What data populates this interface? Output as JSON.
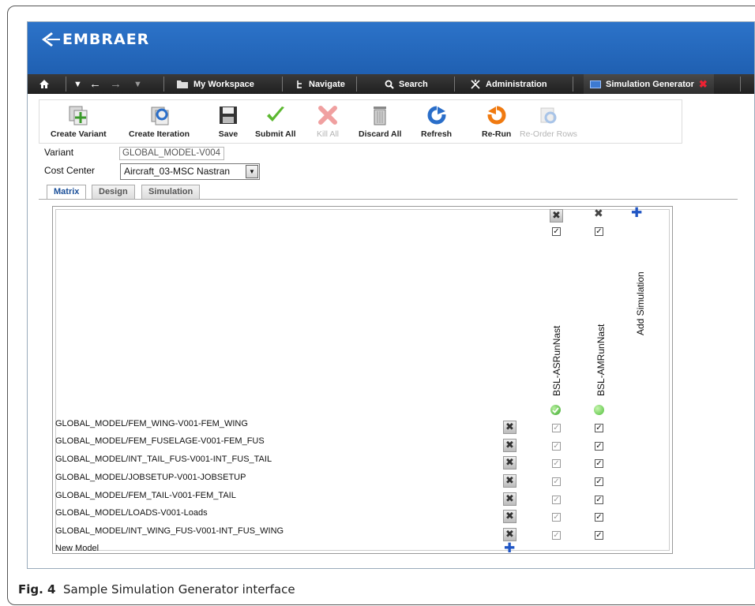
{
  "brand": {
    "name": "EMBRAER"
  },
  "nav": {
    "workspace": "My Workspace",
    "navigate": "Navigate",
    "search": "Search",
    "administration": "Administration",
    "simulation_generator": "Simulation Generator"
  },
  "toolbar": {
    "create_variant": "Create Variant",
    "create_iteration": "Create Iteration",
    "save": "Save",
    "submit_all": "Submit All",
    "kill_all": "Kill All",
    "discard_all": "Discard All",
    "refresh": "Refresh",
    "re_run": "Re-Run",
    "reorder_rows": "Re-Order Rows"
  },
  "form": {
    "variant_label": "Variant",
    "variant_value": "GLOBAL_MODEL-V004",
    "cost_center_label": "Cost Center",
    "cost_center_value": "Aircraft_03-MSC Nastran"
  },
  "tabs": [
    {
      "label": "Matrix",
      "active": true
    },
    {
      "label": "Design",
      "active": false
    },
    {
      "label": "Simulation",
      "active": false
    }
  ],
  "matrix": {
    "columns": [
      {
        "label": "BSL-ASRunNast",
        "status": "complete"
      },
      {
        "label": "BSL-AMRunNast",
        "status": "ready"
      }
    ],
    "add_simulation": "Add Simulation",
    "rows": [
      "GLOBAL_MODEL/FEM_WING-V001-FEM_WING",
      "GLOBAL_MODEL/FEM_FUSELAGE-V001-FEM_FUS",
      "GLOBAL_MODEL/INT_TAIL_FUS-V001-INT_FUS_TAIL",
      "GLOBAL_MODEL/JOBSETUP-V001-JOBSETUP",
      "GLOBAL_MODEL/FEM_TAIL-V001-FEM_TAIL",
      "GLOBAL_MODEL/LOADS-V001-Loads",
      "GLOBAL_MODEL/INT_WING_FUS-V001-INT_FUS_WING"
    ],
    "new_model": "New Model"
  },
  "caption": {
    "label": "Fig. 4",
    "text": "Sample Simulation Generator interface"
  },
  "colors": {
    "banner": "#2c73c9",
    "navbar": "#2a2a2a",
    "accent_blue": "#1f55c4",
    "status_green": "#4fbf3a"
  }
}
